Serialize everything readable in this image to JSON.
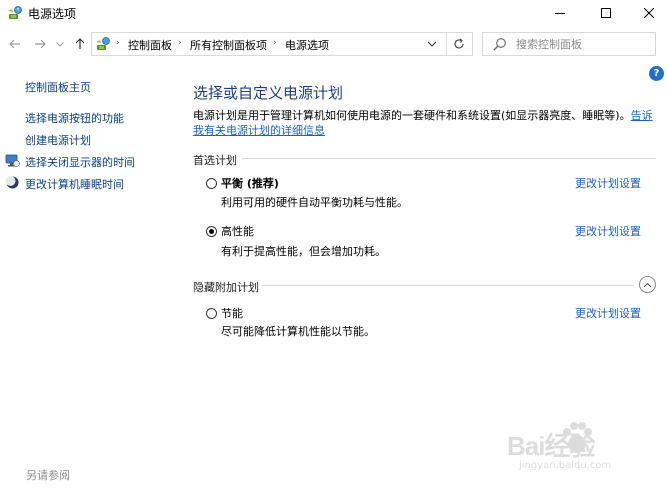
{
  "window": {
    "title": "电源选项",
    "icon": "power-options-icon"
  },
  "address_bar": {
    "breadcrumbs": [
      "控制面板",
      "所有控制面板项",
      "电源选项"
    ],
    "search_placeholder": "搜索控制面板"
  },
  "sidebar": {
    "items": [
      {
        "label": "控制面板主页",
        "icon": ""
      },
      {
        "label": "选择电源按钮的功能",
        "icon": ""
      },
      {
        "label": "创建电源计划",
        "icon": ""
      },
      {
        "label": "选择关闭显示器的时间",
        "icon": "monitor-icon"
      },
      {
        "label": "更改计算机睡眠时间",
        "icon": "moon-icon"
      }
    ],
    "see_also": "另请参阅"
  },
  "main": {
    "title": "选择或自定义电源计划",
    "description": "电源计划是用于管理计算机如何使用电源的一套硬件和系统设置(如显示器亮度、睡眠等)。",
    "description_link": "告诉我有关电源计划的详细信息",
    "preferred_header": "首选计划",
    "hidden_header": "隐藏附加计划",
    "plans": [
      {
        "name": "平衡 (推荐)",
        "desc": "利用可用的硬件自动平衡功耗与性能。",
        "link": "更改计划设置",
        "selected": false
      },
      {
        "name": "高性能",
        "desc": "有利于提高性能，但会增加功耗。",
        "link": "更改计划设置",
        "selected": true
      },
      {
        "name": "节能",
        "desc": "尽可能降低计算机性能以节能。",
        "link": "更改计划设置",
        "selected": false
      }
    ]
  },
  "watermark": {
    "text": "Bai经验",
    "url": "jingyan.baidu.com"
  },
  "colors": {
    "link": "#1a62c4",
    "title": "#1e3f84",
    "sidebar_link": "#0b3f8a",
    "help": "#1f6fce"
  }
}
